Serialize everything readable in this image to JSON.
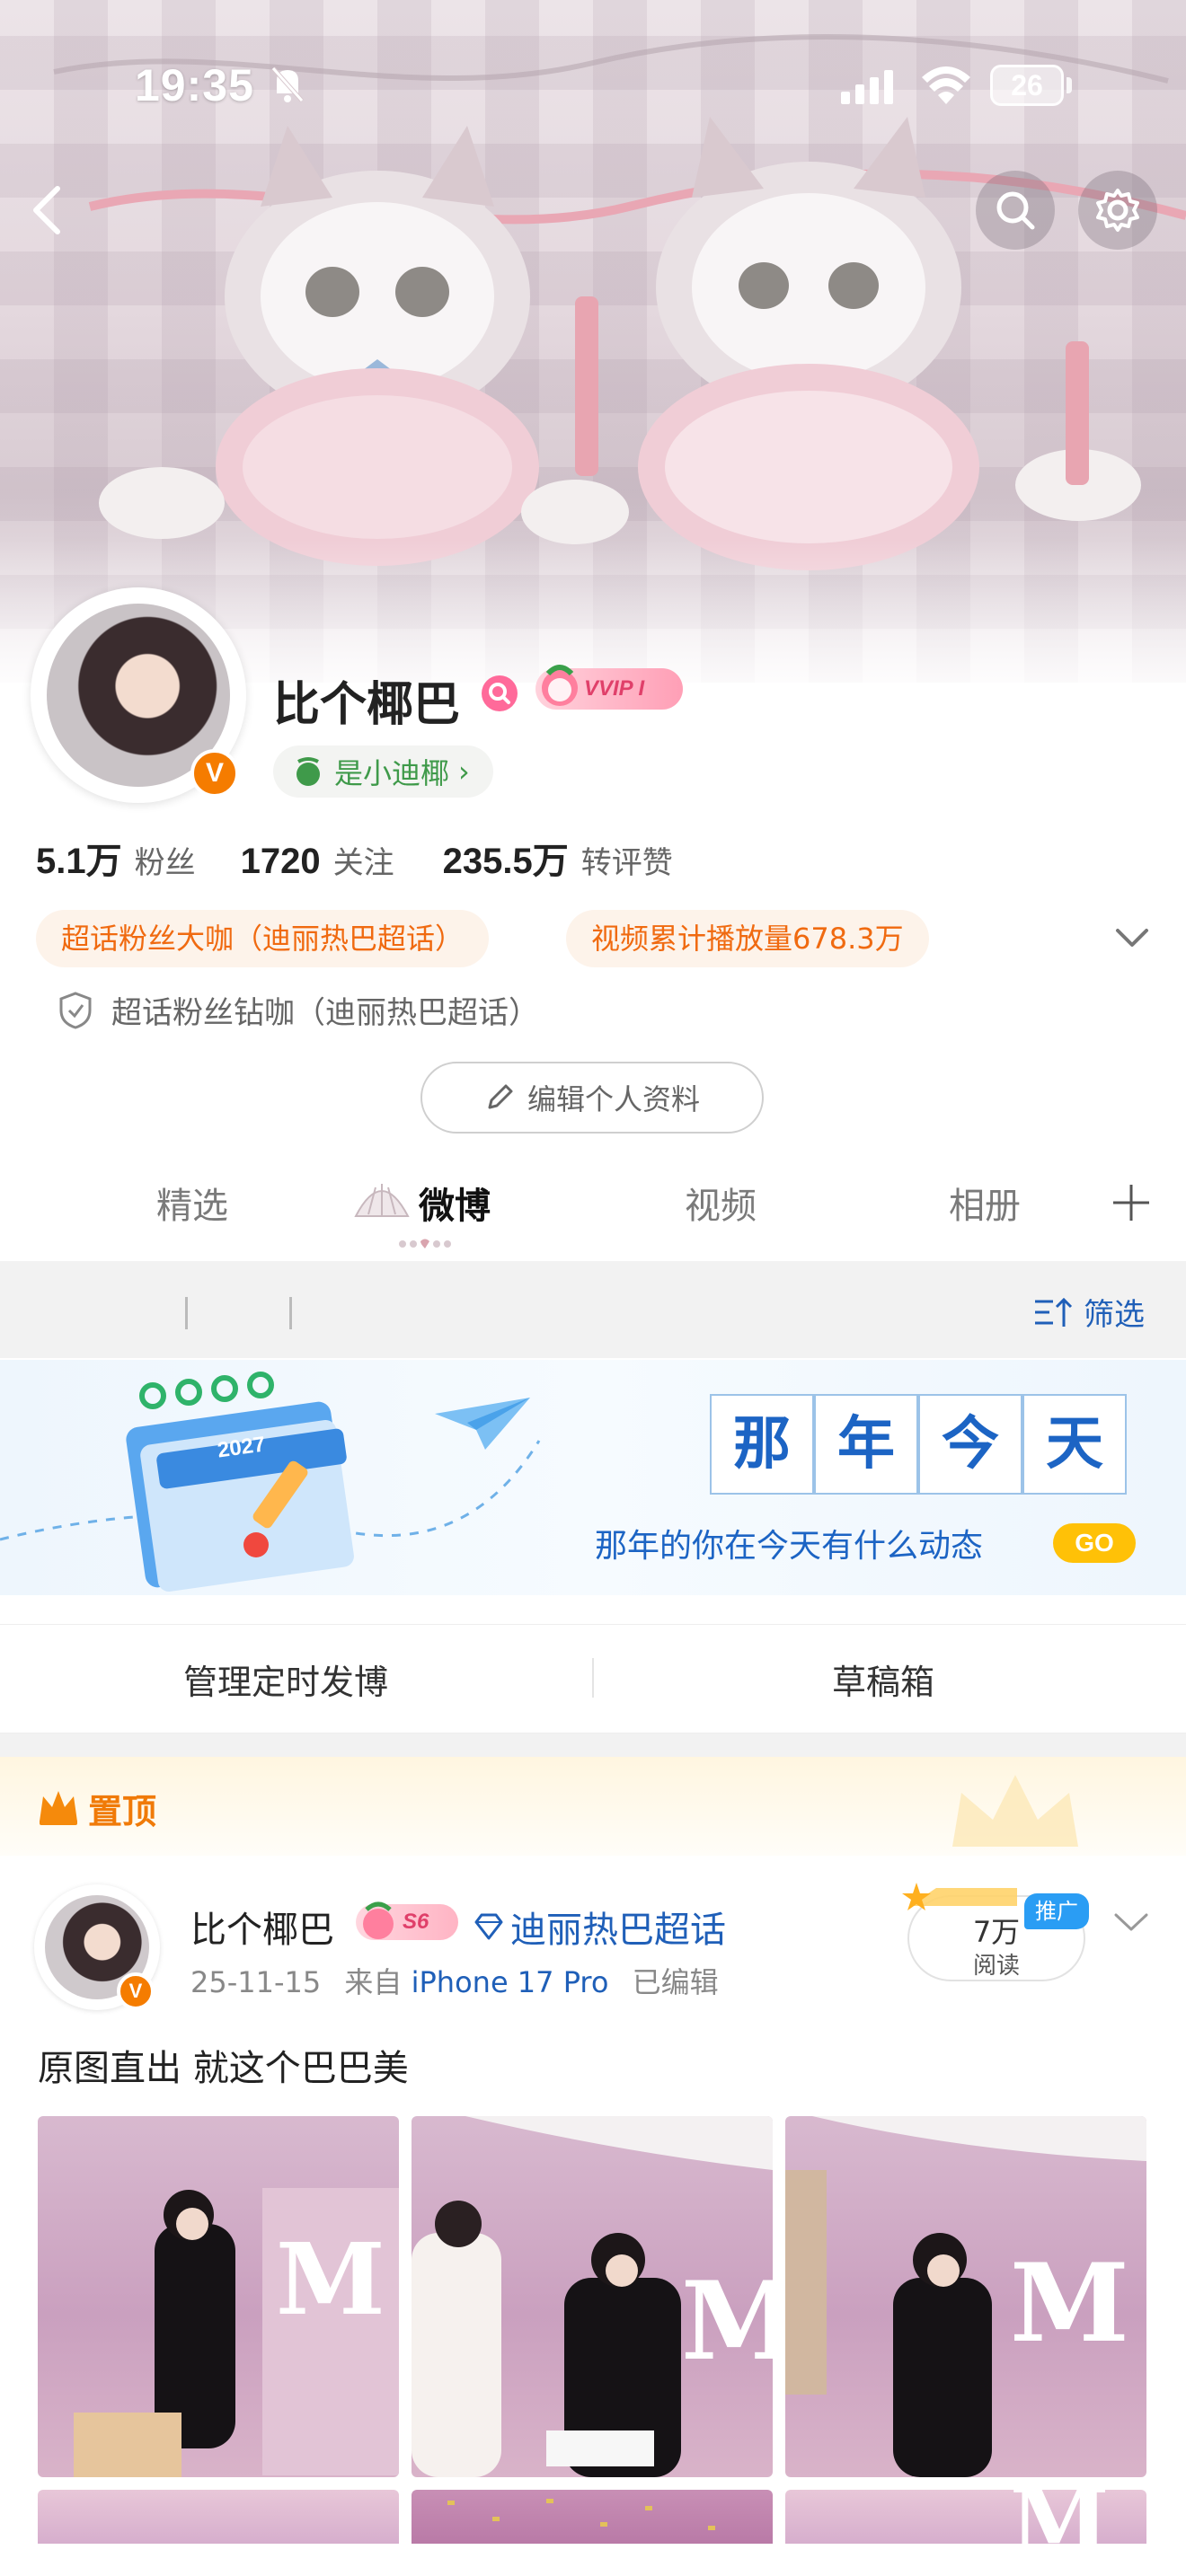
{
  "status_bar": {
    "time": "19:35",
    "battery": "26"
  },
  "profile": {
    "name": "比个椰巴",
    "vip_label": "VVIP I",
    "tag": "是小迪椰",
    "tag_chevron": "›",
    "verified_mark": "V",
    "stats": [
      {
        "value": "5.1万",
        "label": "粉丝"
      },
      {
        "value": "1720",
        "label": "关注"
      },
      {
        "value": "235.5万",
        "label": "转评赞"
      }
    ],
    "badges": [
      "超话粉丝大咖（迪丽热巴超话）",
      "视频累计播放量678.3万"
    ],
    "badge_secondary": "超话粉丝钻咖（迪丽热巴超话）",
    "edit_button": "编辑个人资料"
  },
  "tabs": [
    {
      "label": "精选",
      "active": false
    },
    {
      "label": "微博",
      "active": true
    },
    {
      "label": "视频",
      "active": false
    },
    {
      "label": "相册",
      "active": false
    }
  ],
  "filter_label": "筛选",
  "memory_banner": {
    "title_chars": [
      "那",
      "年",
      "今",
      "天"
    ],
    "subtitle": "那年的你在今天有什么动态",
    "go_label": "GO",
    "calendar_year": "2027"
  },
  "actions": [
    "管理定时发博",
    "草稿箱"
  ],
  "pinned_label": "置顶",
  "post": {
    "author": "比个椰巴",
    "level": "S6",
    "topic": "迪丽热巴超话",
    "date": "25-11-15",
    "from_prefix": "来自",
    "device": "iPhone 17 Pro",
    "edited": "已编辑",
    "reads_value": "7万",
    "reads_label": "阅读",
    "promo_tag": "推广",
    "text": "原图直出 就这个巴巴美"
  },
  "colors": {
    "accent_orange": "#f06a10",
    "link_blue": "#1f5fb8",
    "green": "#3f9a4a",
    "go_yellow": "#ffc107"
  }
}
